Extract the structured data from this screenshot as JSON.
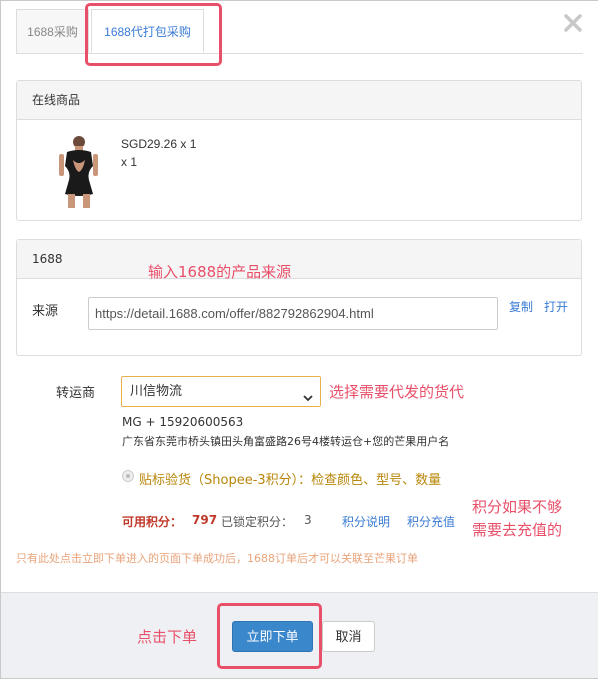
{
  "tabs": [
    {
      "label": "1688采购"
    },
    {
      "label": "1688代打包采购"
    }
  ],
  "online_panel": {
    "title": "在线商品",
    "product": {
      "price_line": "SGD29.26 x 1",
      "qty_line": "x 1"
    }
  },
  "source_panel": {
    "title": "1688",
    "label": "来源",
    "value": "https://detail.1688.com/offer/882792862904.html",
    "copy_label": "复制",
    "open_label": "打开"
  },
  "carrier": {
    "label": "转运商",
    "selected": "川信物流",
    "address_line1": "MG + 15920600563",
    "address_line2": "广东省东莞市桥头镇田头角富盛路26号4楼转运仓+您的芒果用户名"
  },
  "option": {
    "text": "贴标验货（Shopee-3积分）：检查颜色、型号、数量"
  },
  "points": {
    "available_label": "可用积分：",
    "available_value": "797",
    "locked_label": "已锁定积分：",
    "locked_value": "3",
    "explain_label": "积分说明",
    "recharge_label": "积分充值"
  },
  "notice": "只有此处点击立即下单进入的页面下单成功后，1688订单后才可以关联至芒果订单",
  "buttons": {
    "order": "立即下单",
    "cancel": "取消"
  },
  "annotations": {
    "source": "输入1688的产品来源",
    "carrier": "选择需要代发的货代",
    "points_1": "积分如果不够",
    "points_2": "需要去充值的",
    "click": "点击下单"
  },
  "colors": {
    "accent": "#3a7bd5",
    "annotation": "#e8506a",
    "primary_button": "#3a87cc"
  }
}
